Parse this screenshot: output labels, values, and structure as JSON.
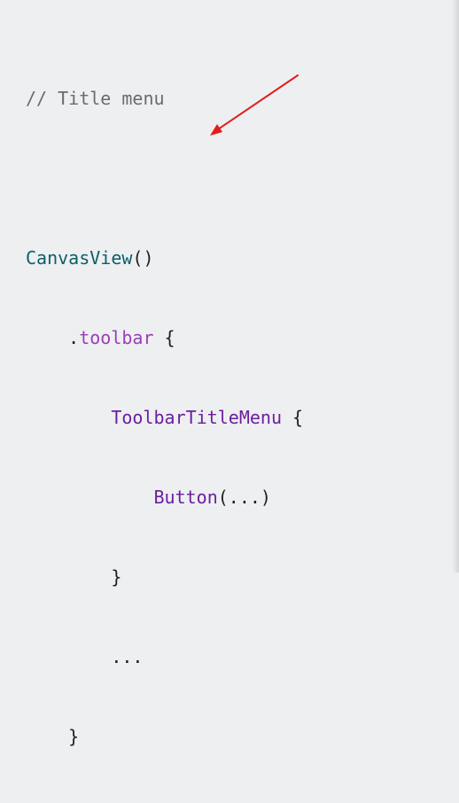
{
  "code": {
    "lines": [
      {
        "segments": [
          {
            "text": "// Title menu",
            "role": "comment"
          }
        ]
      },
      {
        "segments": [
          {
            "text": "",
            "role": "plain"
          }
        ]
      },
      {
        "segments": [
          {
            "text": "CanvasView",
            "role": "type"
          },
          {
            "text": "()",
            "role": "plain"
          }
        ]
      },
      {
        "segments": [
          {
            "text": "    .",
            "role": "plain"
          },
          {
            "text": "toolbar",
            "role": "method"
          },
          {
            "text": " {",
            "role": "plain"
          }
        ]
      },
      {
        "segments": [
          {
            "text": "        ",
            "role": "plain"
          },
          {
            "text": "ToolbarTitleMenu",
            "role": "purple"
          },
          {
            "text": " {",
            "role": "plain"
          }
        ]
      },
      {
        "segments": [
          {
            "text": "            ",
            "role": "plain"
          },
          {
            "text": "Button",
            "role": "purple"
          },
          {
            "text": "(...)",
            "role": "plain"
          }
        ]
      },
      {
        "segments": [
          {
            "text": "        }",
            "role": "plain"
          }
        ]
      },
      {
        "segments": [
          {
            "text": "        ...",
            "role": "plain"
          }
        ]
      },
      {
        "segments": [
          {
            "text": "    }",
            "role": "plain"
          }
        ]
      }
    ]
  },
  "colors": {
    "background": "#eeeff0",
    "annotation_arrow": "#e11d1d"
  }
}
